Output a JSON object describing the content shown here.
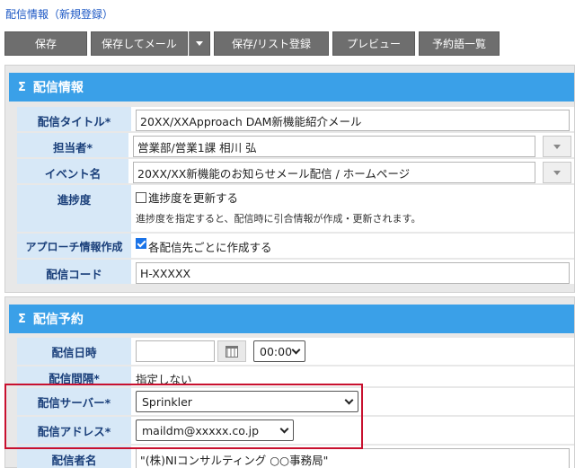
{
  "page": {
    "title": "配信情報（新規登録）"
  },
  "toolbar": {
    "save": "保存",
    "save_mail": "保存してメール",
    "save_list": "保存/リスト登録",
    "preview": "プレビュー",
    "reserved": "予約語一覧"
  },
  "section1": {
    "title": "配信情報",
    "rows": {
      "title_label": "配信タイトル*",
      "title_value": "20XX/XXApproach DAM新機能紹介メール",
      "owner_label": "担当者*",
      "owner_value": "営業部/営業1課 相川 弘",
      "event_label": "イベント名",
      "event_value": "20XX/XX新機能のお知らせメール配信 / ホームページ",
      "progress_label": "進捗度",
      "progress_check": "進捗度を更新する",
      "progress_note": "進捗度を指定すると、配信時に引合情報が作成・更新されます。",
      "approach_label": "アプローチ情報作成",
      "approach_check": "各配信先ごとに作成する",
      "code_label": "配信コード",
      "code_value": "H-XXXXX"
    }
  },
  "section2": {
    "title": "配信予約",
    "rows": {
      "datetime_label": "配信日時",
      "time_value": "00:00",
      "interval_label": "配信間隔*",
      "interval_value": "指定しない",
      "server_label": "配信サーバー*",
      "server_value": "Sprinkler",
      "address_label": "配信アドレス*",
      "address_value": "maildm@xxxxx.co.jp",
      "sender_label": "配信者名",
      "sender_value": "\"(株)NIコンサルティング ○○事務局\""
    }
  },
  "colors": {
    "accent": "#3aa0e8",
    "label_bg": "#d7e8f7",
    "button": "#6e6e6e",
    "highlight": "#c8102e"
  }
}
